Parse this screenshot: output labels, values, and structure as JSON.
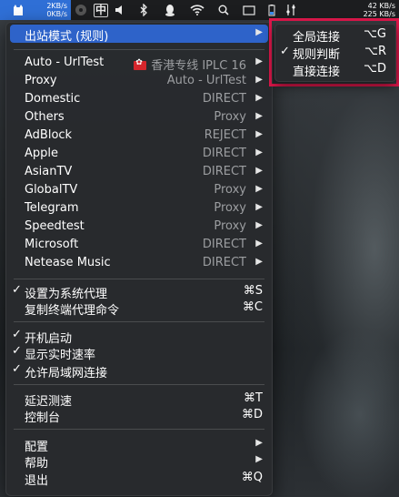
{
  "menubar": {
    "upload_speed": "2KB/s",
    "download_speed": "0KB/s",
    "input_method": "中",
    "right_speed_up": "42 KB/s",
    "right_speed_down": "225 KB/s",
    "icons": [
      "cat-icon",
      "dvd-icon",
      "input-method-icon",
      "volume-icon",
      "bluetooth-icon",
      "qq-icon",
      "wifi-icon",
      "search-icon",
      "screen-icon",
      "battery-icon",
      "controls-icon"
    ]
  },
  "menu": {
    "outbound_mode": {
      "label": "出站模式 (规则)"
    },
    "groups": [
      {
        "label": "Auto - UrlTest",
        "value": "香港专线 IPLC 16",
        "flag": "hong-kong-flag"
      },
      {
        "label": "Proxy",
        "value": "Auto - UrlTest"
      },
      {
        "label": "Domestic",
        "value": "DIRECT"
      },
      {
        "label": "Others",
        "value": "Proxy"
      },
      {
        "label": "AdBlock",
        "value": "REJECT"
      },
      {
        "label": "Apple",
        "value": "DIRECT"
      },
      {
        "label": "AsianTV",
        "value": "DIRECT"
      },
      {
        "label": "GlobalTV",
        "value": "Proxy"
      },
      {
        "label": "Telegram",
        "value": "Proxy"
      },
      {
        "label": "Speedtest",
        "value": "Proxy"
      },
      {
        "label": "Microsoft",
        "value": "DIRECT"
      },
      {
        "label": "Netease Music",
        "value": "DIRECT"
      }
    ],
    "set_system_proxy": {
      "label": "设置为系统代理",
      "shortcut": "⌘S",
      "check": "✓"
    },
    "copy_proxy_cmd": {
      "label": "复制终端代理命令",
      "shortcut": "⌘C"
    },
    "start_at_login": {
      "label": "开机启动",
      "check": "✓"
    },
    "show_speed": {
      "label": "显示实时速率",
      "check": "✓"
    },
    "allow_lan": {
      "label": "允许局域网连接",
      "check": "✓"
    },
    "latency_test": {
      "label": "延迟测速",
      "shortcut": "⌘T"
    },
    "dashboard": {
      "label": "控制台",
      "shortcut": "⌘D"
    },
    "config": {
      "label": "配置"
    },
    "help": {
      "label": "帮助"
    },
    "quit": {
      "label": "退出",
      "shortcut": "⌘Q"
    }
  },
  "submenu": {
    "items": [
      {
        "label": "全局连接",
        "shortcut": "⌥G",
        "check": ""
      },
      {
        "label": "规则判断",
        "shortcut": "⌥R",
        "check": "✓"
      },
      {
        "label": "直接连接",
        "shortcut": "⌥D",
        "check": ""
      }
    ]
  },
  "colors": {
    "highlight": "#2e63c9",
    "annotation_border": "#e0174b",
    "menubar_app": "#2f6fd6"
  }
}
